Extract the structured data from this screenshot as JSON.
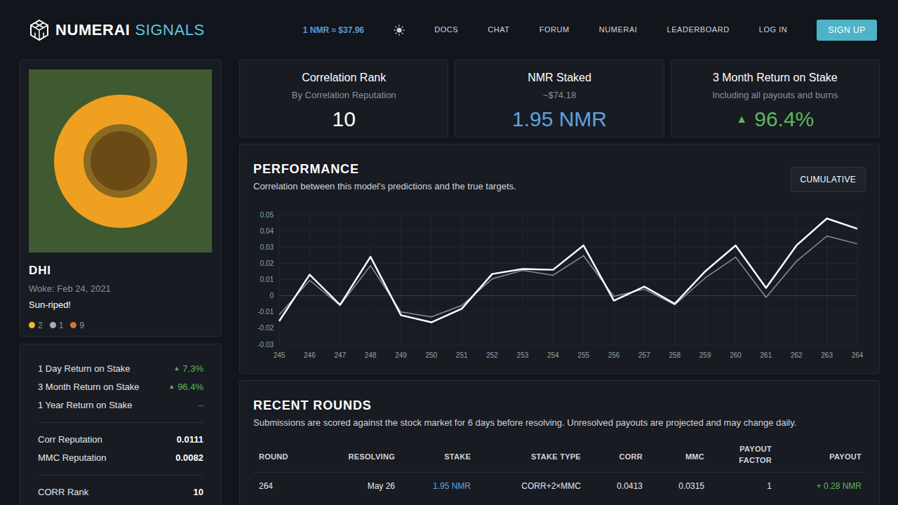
{
  "header": {
    "logo": {
      "primary": "NUMERAI",
      "secondary": "SIGNALS"
    },
    "price": "1 NMR ≈ $37.96",
    "nav": [
      "DOCS",
      "CHAT",
      "FORUM",
      "NUMERAI",
      "LEADERBOARD",
      "LOG IN"
    ],
    "signup": "SIGN UP"
  },
  "profile": {
    "name": "DHI",
    "woke": "Woke: Feb 24, 2021",
    "bio": "Sun-riped!",
    "medals": [
      {
        "count": "2",
        "color": "#f2b632"
      },
      {
        "count": "1",
        "color": "#a9adb3"
      },
      {
        "count": "9",
        "color": "#c9793a"
      }
    ]
  },
  "stat_groups": [
    [
      {
        "label": "1 Day Return on Stake",
        "arrow": "▲",
        "value": "7.3%",
        "kind": "gain"
      },
      {
        "label": "3 Month Return on Stake",
        "arrow": "▲",
        "value": "96.4%",
        "kind": "gain"
      },
      {
        "label": "1 Year Return on Stake",
        "value": "–",
        "kind": "empty"
      }
    ],
    [
      {
        "label": "Corr Reputation",
        "value": "0.0111",
        "kind": "plain"
      },
      {
        "label": "MMC Reputation",
        "value": "0.0082",
        "kind": "plain"
      }
    ],
    [
      {
        "label": "CORR Rank",
        "value": "10",
        "kind": "plain"
      }
    ]
  ],
  "summary_cards": [
    {
      "title": "Correlation Rank",
      "subtitle": "By Correlation Reputation",
      "value": "10",
      "kind": "plain"
    },
    {
      "title": "NMR Staked",
      "subtitle": "~$74.18",
      "value": "1.95 NMR",
      "kind": "stake"
    },
    {
      "title": "3 Month Return on Stake",
      "subtitle": "Including all payouts and burns",
      "arrow": "▲",
      "value": "96.4%",
      "kind": "gain"
    }
  ],
  "performance": {
    "title": "PERFORMANCE",
    "subtitle": "Correlation between this model's predictions and the true targets.",
    "button": "CUMULATIVE",
    "chart": {
      "y_ticks": [
        "0.05",
        "0.04",
        "0.03",
        "0.02",
        "0.01",
        "0",
        "-0.01",
        "-0.02",
        "-0.03"
      ],
      "x_labels": [
        "245",
        "246",
        "247",
        "248",
        "249",
        "250",
        "251",
        "252",
        "253",
        "254",
        "255",
        "256",
        "257",
        "258",
        "259",
        "260",
        "261",
        "262",
        "263",
        "264"
      ],
      "series": [
        {
          "color": "#8a8f98",
          "values": [
            -0.0117,
            0.0095,
            -0.006,
            0.0186,
            -0.01,
            -0.013,
            -0.006,
            0.0104,
            0.0156,
            0.0126,
            0.0247,
            -0.0004,
            0.004,
            -0.0056,
            0.011,
            0.0238,
            -0.001,
            0.0212,
            0.0368,
            0.032
          ]
        },
        {
          "color": "#ffffff",
          "values": [
            -0.0156,
            0.013,
            -0.0056,
            0.024,
            -0.012,
            -0.0164,
            -0.008,
            0.0134,
            0.0165,
            0.016,
            0.031,
            -0.003,
            0.0056,
            -0.005,
            0.015,
            0.031,
            0.0048,
            0.031,
            0.0476,
            0.0413
          ]
        }
      ]
    }
  },
  "recent_rounds": {
    "title": "RECENT ROUNDS",
    "subtitle": "Submissions are scored against the stock market for 6 days before resolving. Unresolved payouts are projected and may change daily.",
    "columns": [
      "ROUND",
      "RESOLVING",
      "STAKE",
      "STAKE TYPE",
      "CORR",
      "MMC",
      "PAYOUT FACTOR",
      "PAYOUT"
    ],
    "rows": [
      [
        "264",
        "May 26",
        "1.95 NMR",
        "CORR+2×MMC",
        "0.0413",
        "0.0315",
        "1",
        "+ 0.28 NMR"
      ]
    ]
  }
}
